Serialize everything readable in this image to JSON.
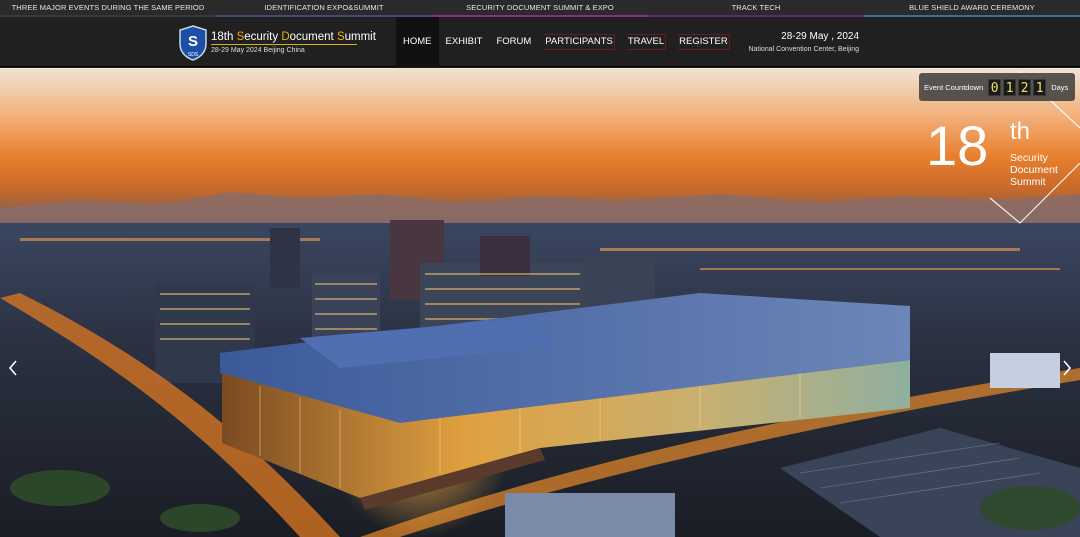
{
  "top_tabs": [
    "THREE MAJOR EVENTS DURING THE SAME PERIOD",
    "IDENTIFICATION EXPO&SUMMIT",
    "SECURITY DOCUMENT SUMMIT & EXPO",
    "TRACK TECH",
    "BLUE SHIELD AWARD CEREMONY"
  ],
  "brand": {
    "logo_text": "SDS",
    "title_parts": [
      "18th ",
      "S",
      "ecurity ",
      "D",
      "ocument ",
      "S",
      "ummit"
    ],
    "subtitle": "28-29 May 2024 Beijing China"
  },
  "nav": [
    "HOME",
    "EXHIBIT",
    "FORUM",
    "PARTICIPANTS",
    "TRAVEL",
    "REGISTER"
  ],
  "event": {
    "dates": "28-29 May , 2024",
    "venue": "National Convention Center, Beijing"
  },
  "countdown": {
    "label": "Event Countdown",
    "digits": [
      "0",
      "1",
      "2",
      "1"
    ],
    "unit": "Days"
  },
  "badge": {
    "number": "18",
    "suffix": "th",
    "lines": [
      "Security",
      "Document",
      "Summit"
    ]
  },
  "icons": {
    "prev": "chevron-left-icon",
    "next": "chevron-right-icon",
    "logo": "shield-logo-icon"
  },
  "colors": {
    "accent_gold": "#f2b300",
    "header_bg": "#202020"
  }
}
